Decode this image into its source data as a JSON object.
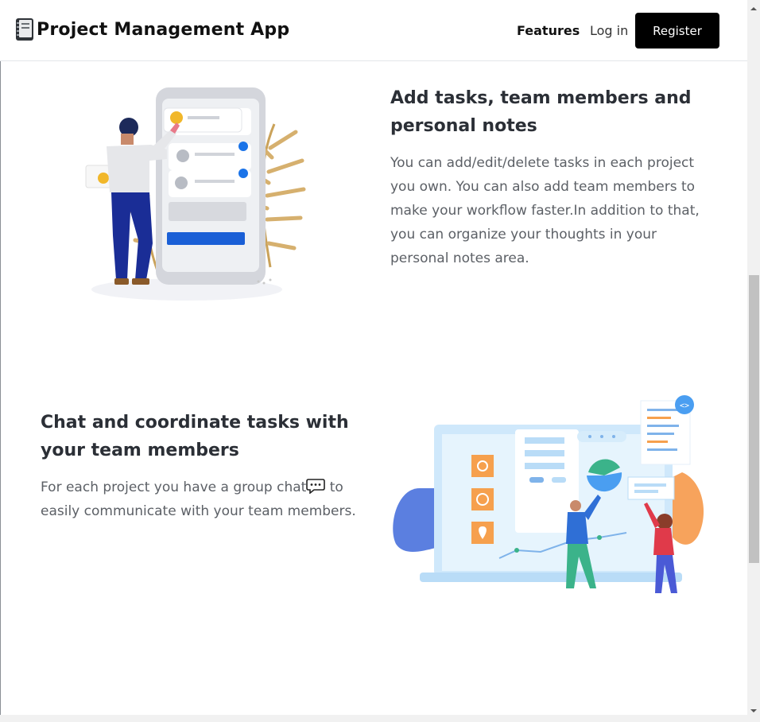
{
  "header": {
    "brand_icon": "notebook-icon",
    "title": "Project Management App",
    "nav": {
      "features": "Features",
      "login": "Log in",
      "register": "Register"
    }
  },
  "features": [
    {
      "title": "Add tasks, team members and personal notes",
      "text": "You can add/edit/delete tasks in each project you own. You can also add team members to make your workflow faster.In addition to that, you can organize your thoughts in your personal notes area.",
      "illustration": "task-list-phone-illustration"
    },
    {
      "title": "Chat and coordinate tasks with your team members",
      "text_before_icon": "For each project you have a group chat",
      "text_after_icon": " to easily communicate with your team members.",
      "inline_icon": "chat-bubble-icon",
      "illustration": "team-dashboard-illustration"
    }
  ],
  "colors": {
    "register_bg": "#000000",
    "accent_blue": "#1a73e8",
    "accent_orange": "#f7a35c"
  }
}
